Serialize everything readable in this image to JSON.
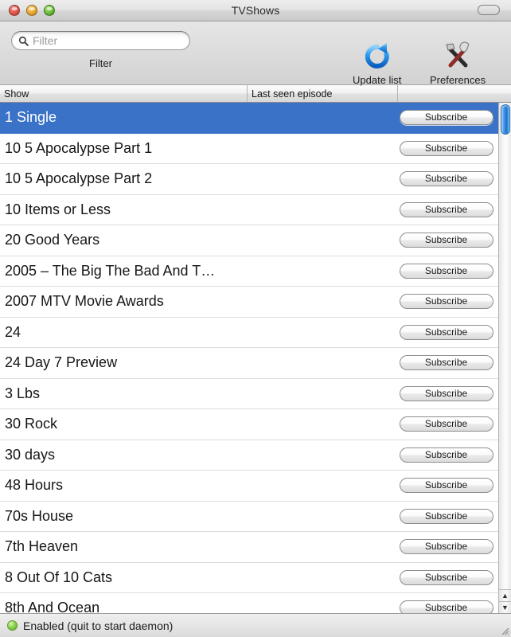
{
  "window": {
    "title": "TVShows",
    "traffic_lights": [
      "close",
      "minimize",
      "zoom"
    ],
    "toolbar_toggle": "toolbar-toggle"
  },
  "toolbar": {
    "filter": {
      "label": "Filter",
      "placeholder": "Filter",
      "value": "",
      "icon": "search-icon"
    },
    "update": {
      "label": "Update list",
      "icon": "refresh-icon"
    },
    "preferences": {
      "label": "Preferences",
      "icon": "tools-icon"
    }
  },
  "table": {
    "columns": [
      {
        "key": "show",
        "label": "Show"
      },
      {
        "key": "last_seen",
        "label": "Last seen episode"
      },
      {
        "key": "action",
        "label": ""
      }
    ],
    "action_label": "Subscribe",
    "rows": [
      {
        "show": "1 Single",
        "last_seen": "",
        "selected": true
      },
      {
        "show": "10 5 Apocalypse Part 1",
        "last_seen": "",
        "selected": false
      },
      {
        "show": "10 5 Apocalypse Part 2",
        "last_seen": "",
        "selected": false
      },
      {
        "show": "10 Items or Less",
        "last_seen": "",
        "selected": false
      },
      {
        "show": "20 Good Years",
        "last_seen": "",
        "selected": false
      },
      {
        "show": "2005 – The Big The Bad And T…",
        "last_seen": "",
        "selected": false
      },
      {
        "show": "2007 MTV Movie Awards",
        "last_seen": "",
        "selected": false
      },
      {
        "show": "24",
        "last_seen": "",
        "selected": false
      },
      {
        "show": "24 Day 7 Preview",
        "last_seen": "",
        "selected": false
      },
      {
        "show": "3 Lbs",
        "last_seen": "",
        "selected": false
      },
      {
        "show": "30 Rock",
        "last_seen": "",
        "selected": false
      },
      {
        "show": "30 days",
        "last_seen": "",
        "selected": false
      },
      {
        "show": "48 Hours",
        "last_seen": "",
        "selected": false
      },
      {
        "show": "70s House",
        "last_seen": "",
        "selected": false
      },
      {
        "show": "7th Heaven",
        "last_seen": "",
        "selected": false
      },
      {
        "show": "8 Out Of 10 Cats",
        "last_seen": "",
        "selected": false
      },
      {
        "show": "8th And Ocean",
        "last_seen": "",
        "selected": false
      }
    ]
  },
  "scrollbar": {
    "up_arrow": "▲",
    "down_arrow": "▼",
    "thumb_position_pct": 0
  },
  "status": {
    "indicator": "enabled",
    "indicator_color": "#8fd14f",
    "text": "Enabled (quit to start daemon)"
  },
  "colors": {
    "selection": "#3a72c8",
    "toolbar_bg": "#dcdcdc",
    "list_bg": "#ffffff"
  }
}
